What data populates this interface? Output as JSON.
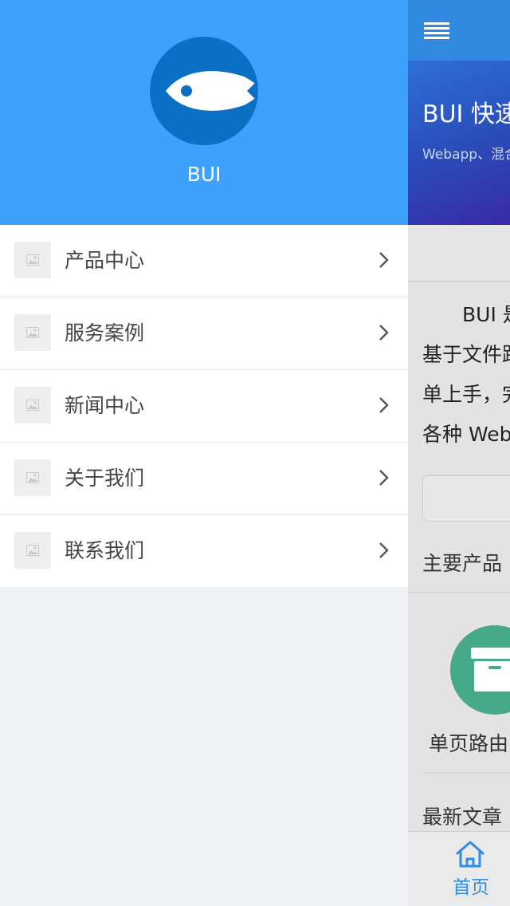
{
  "drawer": {
    "brand": "BUI",
    "items": [
      {
        "label": "产品中心",
        "icon": "image-placeholder-icon"
      },
      {
        "label": "服务案例",
        "icon": "image-placeholder-icon"
      },
      {
        "label": "新闻中心",
        "icon": "image-placeholder-icon"
      },
      {
        "label": "关于我们",
        "icon": "image-placeholder-icon"
      },
      {
        "label": "联系我们",
        "icon": "image-placeholder-icon"
      }
    ]
  },
  "main": {
    "banner_title": "BUI 快速",
    "banner_subtitle": "Webapp、混合",
    "intro": [
      "BUI 是",
      "基于文件路",
      "单上手，完",
      "各种 Web"
    ],
    "section_products": "主要产品",
    "product_label": "单页路由",
    "section_articles": "最新文章"
  },
  "tabbar": {
    "home_label": "首页"
  },
  "colors": {
    "header_blue": "#3ea1fb",
    "logo_blue": "#0a70c4",
    "topbar_blue": "#3289e0",
    "accent_green": "#45a98a",
    "tab_active": "#2f8de4"
  }
}
